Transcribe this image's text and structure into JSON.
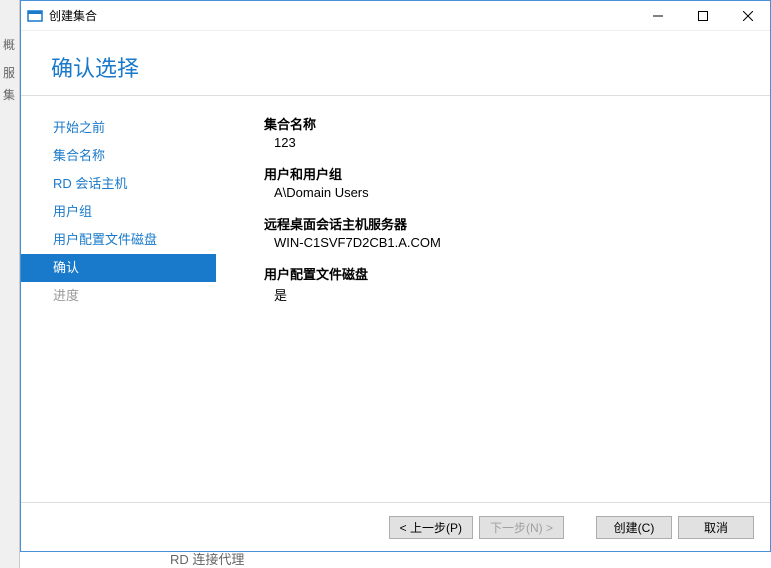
{
  "window": {
    "title": "创建集合",
    "minimize": "—",
    "maximize": "☐",
    "close": "✕"
  },
  "header": {
    "title": "确认选择"
  },
  "background": {
    "l1": "概",
    "l2": "服",
    "l3": "集"
  },
  "sidebar": {
    "steps": [
      {
        "label": "开始之前"
      },
      {
        "label": "集合名称"
      },
      {
        "label": "RD 会话主机"
      },
      {
        "label": "用户组"
      },
      {
        "label": "用户配置文件磁盘"
      },
      {
        "label": "确认"
      },
      {
        "label": "进度"
      }
    ]
  },
  "main": {
    "s1_label": "集合名称",
    "s1_value": "123",
    "s2_label": "用户和用户组",
    "s2_value": "A\\Domain Users",
    "s3_label": "远程桌面会话主机服务器",
    "s3_value": "WIN-C1SVF7D2CB1.A.COM",
    "s4_label": "用户配置文件磁盘",
    "s4_value": "是"
  },
  "footer": {
    "prev": "< 上一步(P)",
    "next": "下一步(N) >",
    "create": "创建(C)",
    "cancel": "取消"
  },
  "peek": "RD 连接代理"
}
